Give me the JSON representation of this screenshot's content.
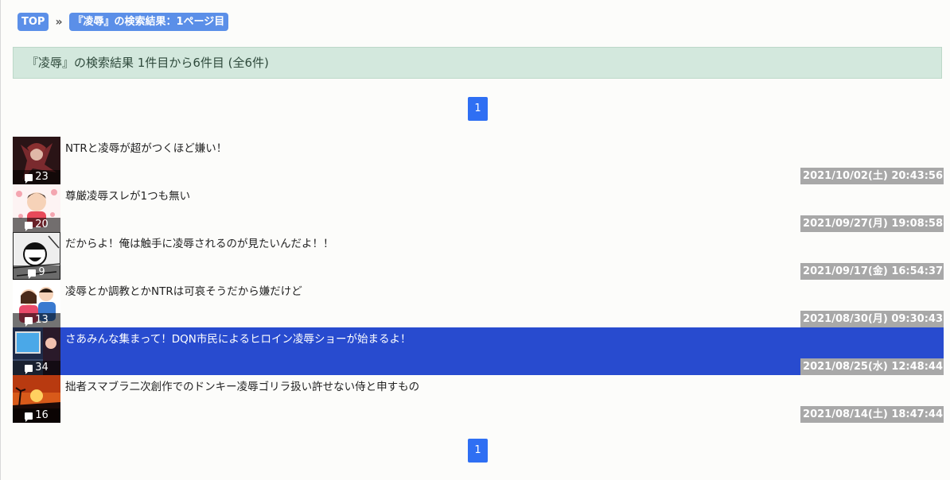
{
  "breadcrumb": {
    "top": "TOP",
    "separator": "»",
    "current": "『凌辱』の検索結果：1ページ目"
  },
  "result_summary": "『凌辱』の検索結果 1件目から6件目 (全6件)",
  "pagination": {
    "top": "1",
    "bottom": "1"
  },
  "colors": {
    "accent": "#2f6ff3",
    "highlight": "#284bcf",
    "summary_bg": "#d3e8dd"
  },
  "threads": [
    {
      "title": "NTRと凌辱が超がつくほど嫌い！",
      "count": "23",
      "date": "2021/10/02(土) 20:43:56"
    },
    {
      "title": "尊厳凌辱スレが1つも無い",
      "count": "20",
      "date": "2021/09/27(月) 19:08:58"
    },
    {
      "title": "だからよ！俺は触手に凌辱されるのが見たいんだよ！！",
      "count": "9",
      "date": "2021/09/17(金) 16:54:37"
    },
    {
      "title": "凌辱とか調教とかNTRは可哀そうだから嫌だけど",
      "count": "13",
      "date": "2021/08/30(月) 09:30:43"
    },
    {
      "title": "さあみんな集まって！DQN市民によるヒロイン凌辱ショーが始まるよ！",
      "count": "34",
      "date": "2021/08/25(水) 12:48:44"
    },
    {
      "title": "拙者スマブラ二次創作でのドンキー凌辱ゴリラ扱い許せない侍と申すもの",
      "count": "16",
      "date": "2021/08/14(土) 18:47:44"
    }
  ]
}
